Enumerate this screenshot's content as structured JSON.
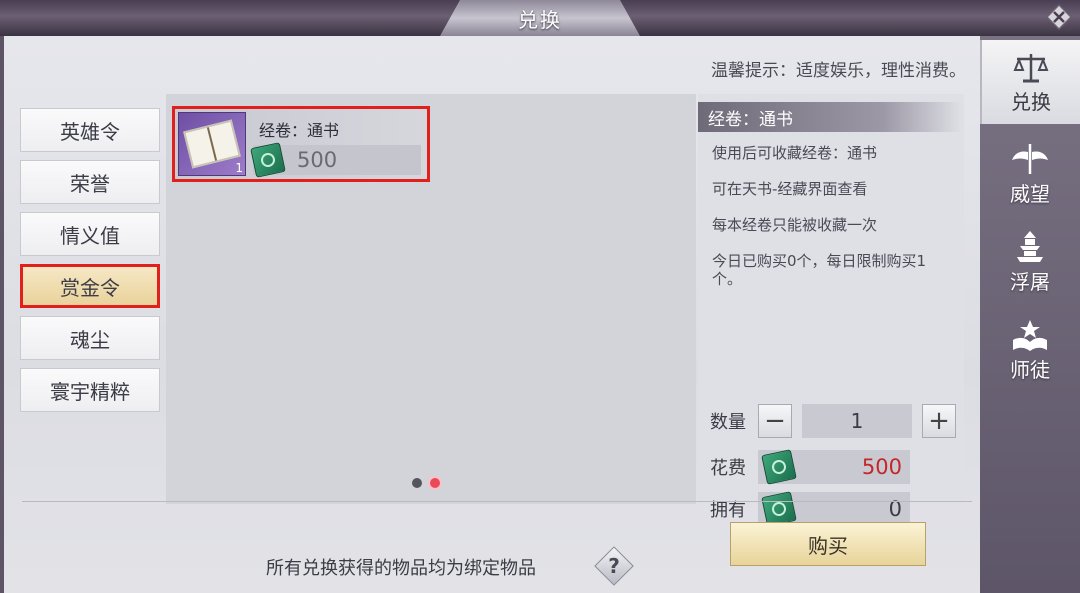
{
  "window": {
    "title": "兑换"
  },
  "tip": "温馨提示：适度娱乐，理性消费。",
  "categories": [
    {
      "label": "英雄令",
      "active": false
    },
    {
      "label": "荣誉",
      "active": false
    },
    {
      "label": "情义值",
      "active": false
    },
    {
      "label": "赏金令",
      "active": true
    },
    {
      "label": "魂尘",
      "active": false
    },
    {
      "label": "寰宇精粹",
      "active": false
    }
  ],
  "goods": [
    {
      "name": "经卷：通书",
      "price": "500",
      "count": "1",
      "icon": "scroll-book-icon"
    }
  ],
  "pager": {
    "total": 2,
    "current": 2
  },
  "detail": {
    "title": "经卷：通书",
    "lines": [
      "使用后可收藏经卷：通书",
      "可在天书-经藏界面查看",
      "每本经卷只能被收藏一次",
      "今日已购买0个，每日限制购买1个。"
    ],
    "quantity_label": "数量",
    "quantity": "1",
    "cost_label": "花费",
    "cost": "500",
    "own_label": "拥有",
    "own": "0"
  },
  "bottom_note": "所有兑换获得的物品均为绑定物品",
  "help_label": "?",
  "buy_label": "购买",
  "side_tabs": [
    {
      "label": "兑换",
      "icon": "scales-icon",
      "active": true
    },
    {
      "label": "威望",
      "icon": "wings-sword-icon",
      "active": false
    },
    {
      "label": "浮屠",
      "icon": "pagoda-icon",
      "active": false
    },
    {
      "label": "师徒",
      "icon": "book-star-icon",
      "active": false
    }
  ],
  "colors": {
    "highlight": "#e0201c",
    "cost_text": "#c4262a"
  }
}
